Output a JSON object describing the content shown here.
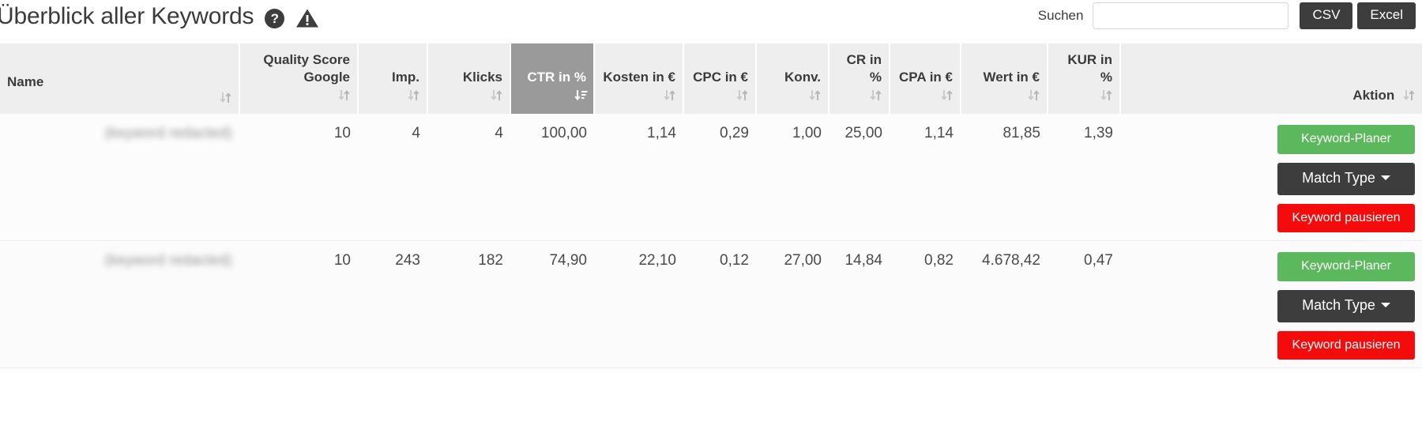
{
  "header": {
    "title": "Überblick aller Keywords",
    "help_icon": "question-circle-icon",
    "warning_icon": "warning-triangle-icon",
    "search_label": "Suchen",
    "search_value": "",
    "search_placeholder": "",
    "csv_label": "CSV",
    "excel_label": "Excel"
  },
  "table": {
    "sorted_column": "CTR in %",
    "sort_direction": "desc",
    "columns": [
      {
        "label": "Name",
        "align": "left",
        "sorted": false
      },
      {
        "label": "Quality Score Google",
        "align": "right",
        "sorted": false
      },
      {
        "label": "Imp.",
        "align": "right",
        "sorted": false
      },
      {
        "label": "Klicks",
        "align": "right",
        "sorted": false
      },
      {
        "label": "CTR in %",
        "align": "right",
        "sorted": true
      },
      {
        "label": "Kosten in €",
        "align": "right",
        "sorted": false
      },
      {
        "label": "CPC in €",
        "align": "right",
        "sorted": false
      },
      {
        "label": "Konv.",
        "align": "right",
        "sorted": false
      },
      {
        "label": "CR in %",
        "align": "right",
        "sorted": false
      },
      {
        "label": "CPA in €",
        "align": "right",
        "sorted": false
      },
      {
        "label": "Wert in €",
        "align": "right",
        "sorted": false
      },
      {
        "label": "KUR in %",
        "align": "right",
        "sorted": false
      },
      {
        "label": "Aktion",
        "align": "right",
        "sorted": false
      }
    ],
    "rows": [
      {
        "name": "(keyword redacted)",
        "quality_score": "10",
        "impressions": "4",
        "klicks": "4",
        "ctr": "100,00",
        "kosten": "1,14",
        "cpc": "0,29",
        "konv": "1,00",
        "cr": "25,00",
        "cpa": "1,14",
        "wert": "81,85",
        "kur": "1,39"
      },
      {
        "name": "(keyword redacted)",
        "quality_score": "10",
        "impressions": "243",
        "klicks": "182",
        "ctr": "74,90",
        "kosten": "22,10",
        "cpc": "0,12",
        "konv": "27,00",
        "cr": "14,84",
        "cpa": "0,82",
        "wert": "4.678,42",
        "kur": "0,47"
      }
    ],
    "actions": {
      "planner_label": "Keyword-Planer",
      "match_type_label": "Match Type",
      "pause_label": "Keyword pausieren"
    }
  },
  "colors": {
    "header_bg": "#eeeeee",
    "sorted_header_bg": "#9a9a9a",
    "dark_button": "#3d3d3d",
    "green_button": "#5cb85c",
    "red_button": "#f40c0c"
  }
}
